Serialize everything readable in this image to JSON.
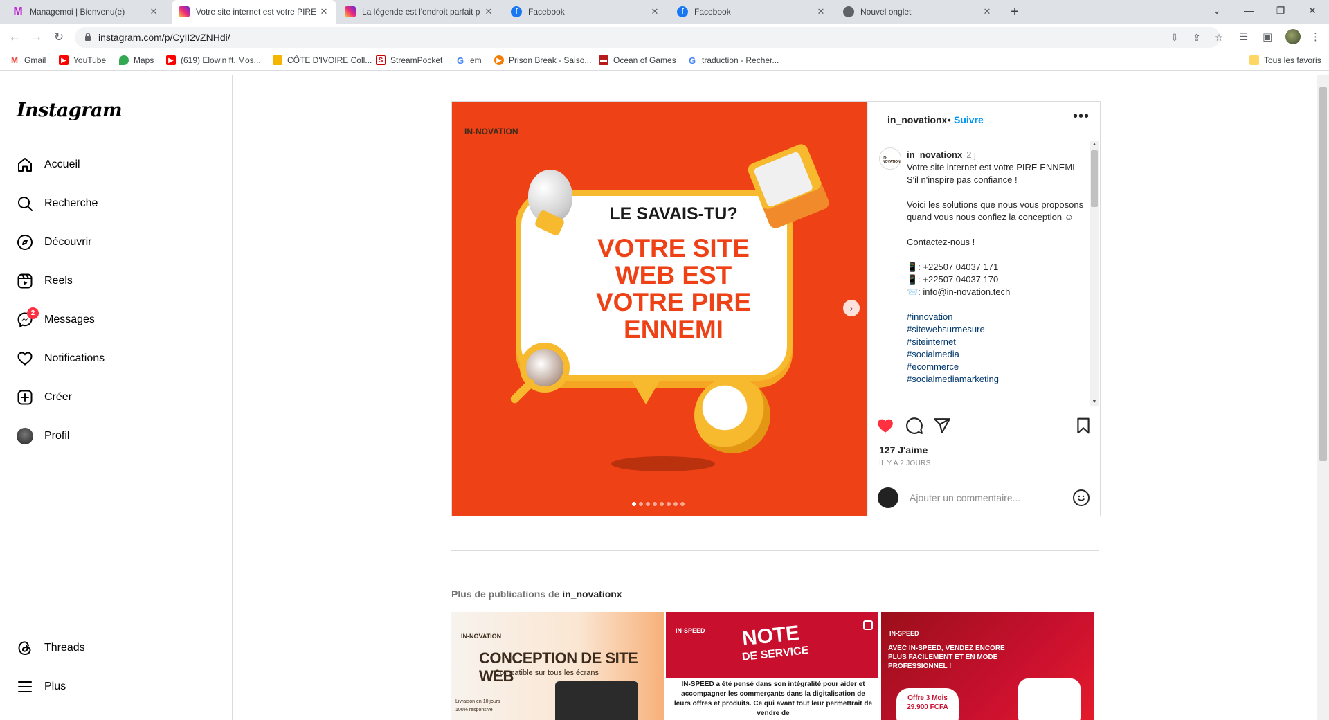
{
  "browser": {
    "tabs": [
      {
        "title": "Managemoi | Bienvenu(e)",
        "icon": "managemoi-icon"
      },
      {
        "title": "Votre site internet est votre PIRE",
        "icon": "instagram-icon"
      },
      {
        "title": "La légende est l'endroit parfait p",
        "icon": "instagram-icon"
      },
      {
        "title": "Facebook",
        "icon": "facebook-icon"
      },
      {
        "title": "Facebook",
        "icon": "facebook-icon"
      },
      {
        "title": "Nouvel onglet",
        "icon": "chrome-icon"
      }
    ],
    "url": "instagram.com/p/CyII2vZNHdi/",
    "bookmarks": [
      {
        "label": "Gmail",
        "icon": "gmail-icon"
      },
      {
        "label": "YouTube",
        "icon": "youtube-icon"
      },
      {
        "label": "Maps",
        "icon": "maps-icon"
      },
      {
        "label": "(619) Elow'n ft. Mos...",
        "icon": "youtube-icon"
      },
      {
        "label": "CÔTE D'IVOIRE Coll...",
        "icon": "page-icon"
      },
      {
        "label": "StreamPocket",
        "icon": "streampocket-icon"
      },
      {
        "label": "em",
        "icon": "google-icon"
      },
      {
        "label": "Prison Break - Saiso...",
        "icon": "play-icon"
      },
      {
        "label": "Ocean of Games",
        "icon": "gamepad-icon"
      },
      {
        "label": "traduction - Recher...",
        "icon": "google-icon"
      }
    ],
    "all_bookmarks": "Tous les favoris"
  },
  "sidebar": {
    "logo": "Instagram",
    "items": [
      {
        "label": "Accueil",
        "icon": "home-icon"
      },
      {
        "label": "Recherche",
        "icon": "search-icon"
      },
      {
        "label": "Découvrir",
        "icon": "compass-icon"
      },
      {
        "label": "Reels",
        "icon": "reels-icon"
      },
      {
        "label": "Messages",
        "icon": "messenger-icon",
        "badge": "2"
      },
      {
        "label": "Notifications",
        "icon": "heart-icon"
      },
      {
        "label": "Créer",
        "icon": "plus-square-icon"
      },
      {
        "label": "Profil",
        "icon": "avatar"
      }
    ],
    "bottom": [
      {
        "label": "Threads",
        "icon": "threads-icon"
      },
      {
        "label": "Plus",
        "icon": "menu-icon"
      }
    ]
  },
  "post": {
    "image": {
      "brand": "IN-NOVATION",
      "heading": "LE SAVAIS-TU?",
      "headline": [
        "VOTRE SITE",
        "WEB EST",
        "VOTRE PIRE",
        "ENNEMI"
      ],
      "slide_count": 8,
      "current_slide": 1
    },
    "author": "in_novationx",
    "separator": "•",
    "follow": "Suivre",
    "caption": {
      "user": "in_novationx",
      "time": "2 j",
      "lines": [
        "Votre site internet est votre PIRE ENNEMI",
        "S'il n'inspire pas confiance !",
        "",
        "Voici les solutions que nous vous proposons quand vous nous confiez la conception ☺",
        "",
        "Contactez-nous !",
        "",
        "📱: +22507 04037 171",
        "📱: +22507 04037 170",
        "📨: info@in-novation.tech",
        ""
      ],
      "hashtags": [
        "#innovation",
        "#sitewebsurmesure",
        "#siteinternet",
        "#socialmedia",
        "#ecommerce",
        "#socialmediamarketing"
      ]
    },
    "likes": "127 J'aime",
    "ago": "IL Y A 2 JOURS",
    "comment_placeholder": "Ajouter un commentaire...",
    "colors": {
      "accent": "#0095f6",
      "like": "#ff3040",
      "post_bg": "#ee4116"
    }
  },
  "more": {
    "prefix": "Plus de publications de ",
    "user": "in_novationx",
    "thumbs": [
      {
        "brand": "IN-NOVATION",
        "title": "CONCEPTION DE SITE WEB",
        "subtitle": "Compatible sur tous les écrans",
        "bullets": [
          "Livraison en 10 jours",
          "100% responsive"
        ]
      },
      {
        "brand": "IN-SPEED",
        "title": "NOTE",
        "subtitle": "DE SERVICE",
        "text": "IN-SPEED a été pensé dans son intégralité pour aider et accompagner les commerçants dans la digitalisation de leurs offres et produits. Ce qui avant tout leur permettrait de vendre de"
      },
      {
        "brand": "IN-SPEED",
        "text": "AVEC IN-SPEED, VENDEZ ENCORE PLUS FACILEMENT ET EN MODE PROFESSIONNEL !",
        "offer": "Offre 3 Mois",
        "price": "29.900 FCFA"
      }
    ]
  }
}
